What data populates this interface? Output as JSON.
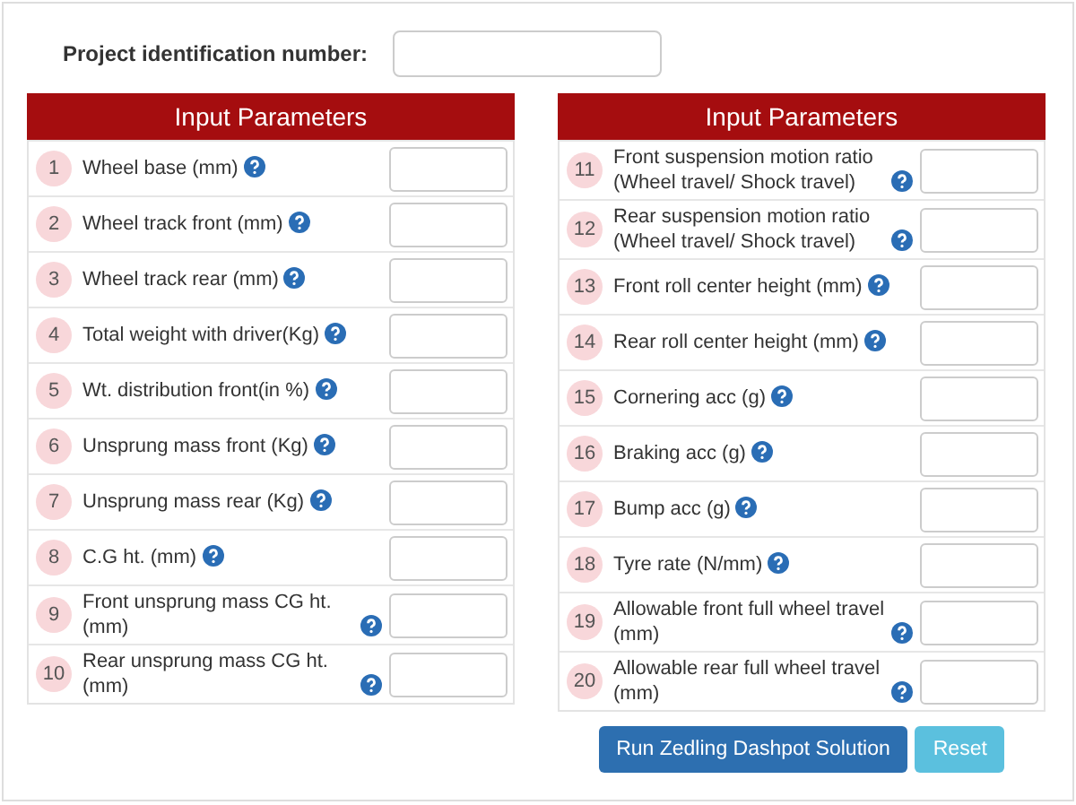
{
  "project_field": {
    "label": "Project identification number:"
  },
  "panels": [
    {
      "title": "Input Parameters",
      "rows": [
        {
          "number": "1",
          "label": "Wheel base (mm)"
        },
        {
          "number": "2",
          "label": "Wheel track front (mm)"
        },
        {
          "number": "3",
          "label": "Wheel track rear (mm)"
        },
        {
          "number": "4",
          "label": "Total weight with driver(Kg)"
        },
        {
          "number": "5",
          "label": "Wt. distribution front(in %)"
        },
        {
          "number": "6",
          "label": "Unsprung mass front (Kg)"
        },
        {
          "number": "7",
          "label": "Unsprung mass rear (Kg)"
        },
        {
          "number": "8",
          "label": "C.G ht. (mm)"
        },
        {
          "number": "9",
          "label": "Front unsprung mass CG ht. (mm)"
        },
        {
          "number": "10",
          "label": "Rear unsprung mass CG ht. (mm)"
        }
      ]
    },
    {
      "title": "Input Parameters",
      "rows": [
        {
          "number": "11",
          "label": "Front suspension motion ratio (Wheel travel/ Shock travel)"
        },
        {
          "number": "12",
          "label": "Rear suspension motion ratio (Wheel travel/ Shock travel)"
        },
        {
          "number": "13",
          "label": "Front roll center height (mm)"
        },
        {
          "number": "14",
          "label": "Rear roll center height (mm)"
        },
        {
          "number": "15",
          "label": "Cornering acc (g)"
        },
        {
          "number": "16",
          "label": "Braking acc (g)"
        },
        {
          "number": "17",
          "label": "Bump acc (g)"
        },
        {
          "number": "18",
          "label": "Tyre rate (N/mm)"
        },
        {
          "number": "19",
          "label": "Allowable front full wheel travel (mm)"
        },
        {
          "number": "20",
          "label": "Allowable rear full wheel travel (mm)"
        }
      ]
    }
  ],
  "buttons": [
    {
      "label": "Run Zedling Dashpot Solution",
      "kind": "primary"
    },
    {
      "label": "Reset",
      "kind": "info"
    }
  ]
}
